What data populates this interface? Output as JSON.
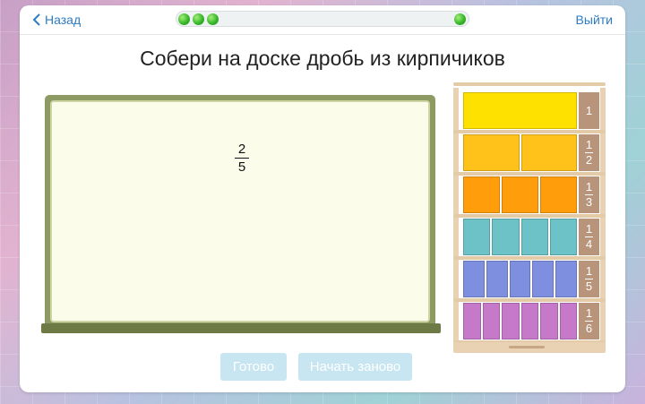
{
  "header": {
    "back_label": "Назад",
    "exit_label": "Выйти",
    "progress": {
      "completed_dots": 3,
      "total_markers": 4,
      "accent": "#37b82a"
    }
  },
  "title": "Собери на доске дробь из кирпичиков",
  "board": {
    "fraction": {
      "numerator": "2",
      "denominator": "5"
    }
  },
  "shelf": {
    "rows": [
      {
        "label_num": "1",
        "label_den": "",
        "bricks": 1,
        "color": "#ffe100"
      },
      {
        "label_num": "1",
        "label_den": "2",
        "bricks": 2,
        "color": "#ffc21a"
      },
      {
        "label_num": "1",
        "label_den": "3",
        "bricks": 3,
        "color": "#ff9d0a"
      },
      {
        "label_num": "1",
        "label_den": "4",
        "bricks": 4,
        "color": "#6cc2c6"
      },
      {
        "label_num": "1",
        "label_den": "5",
        "bricks": 5,
        "color": "#7f8fe0"
      },
      {
        "label_num": "1",
        "label_den": "6",
        "bricks": 6,
        "color": "#c679c9"
      }
    ]
  },
  "buttons": {
    "done_label": "Готово",
    "restart_label": "Начать заново"
  }
}
